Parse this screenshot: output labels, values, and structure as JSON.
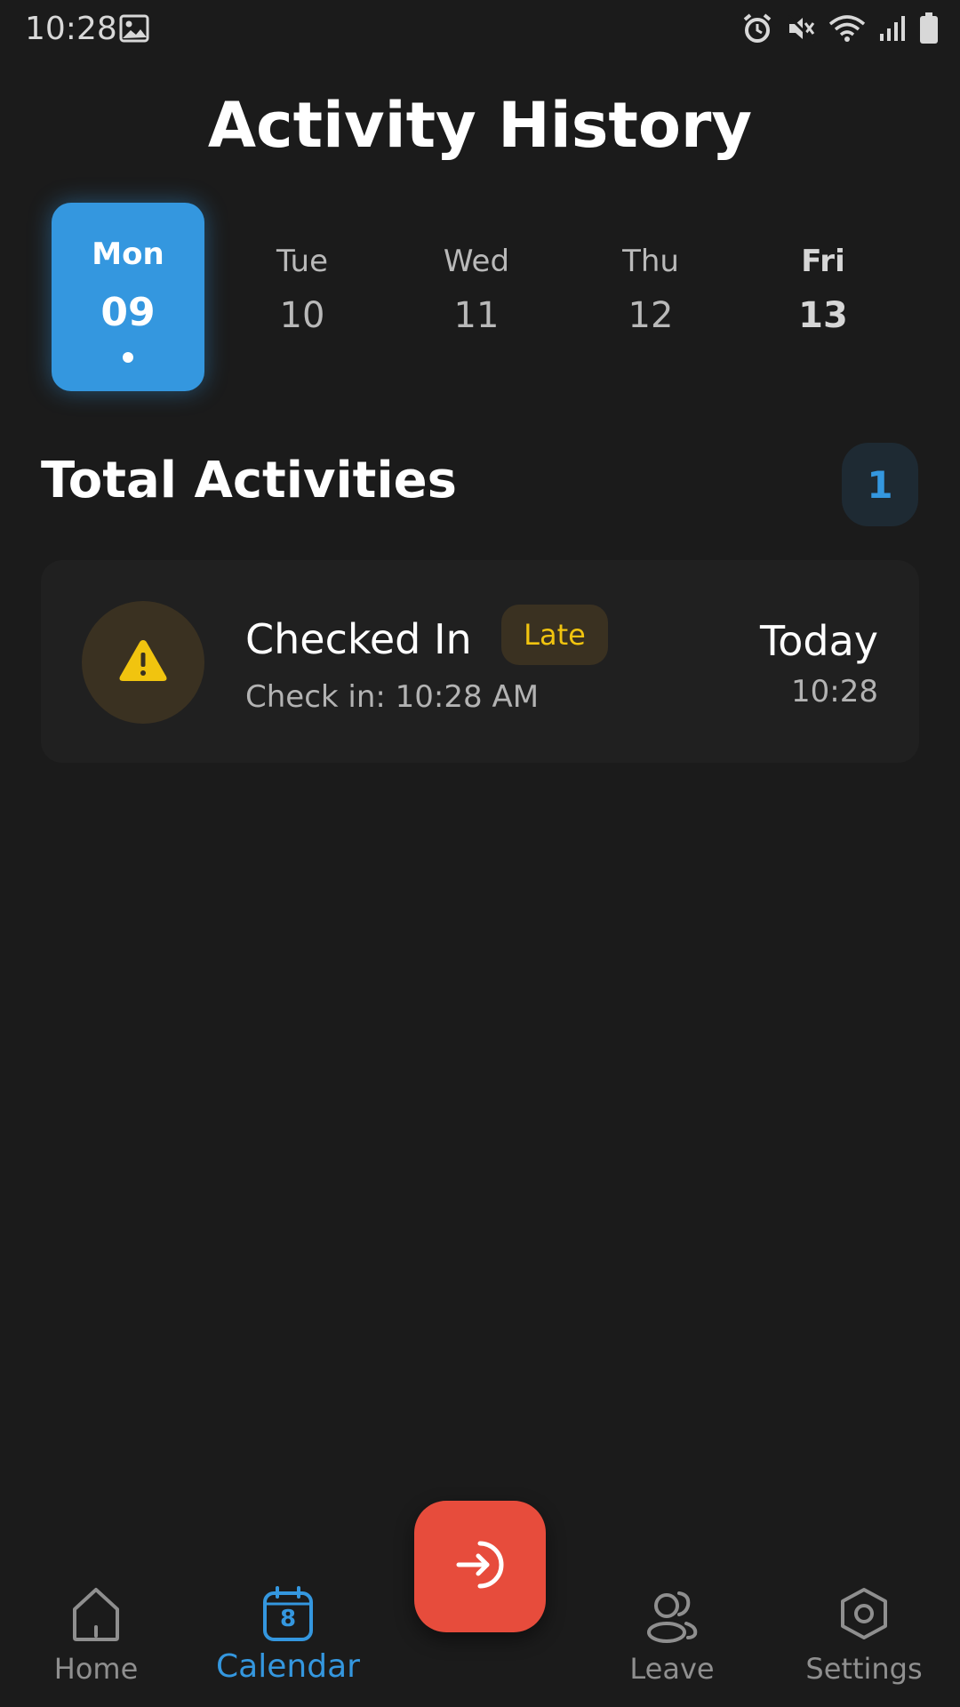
{
  "status_bar": {
    "time": "10:28",
    "icons": [
      "gallery-icon",
      "alarm-icon",
      "mute-icon",
      "wifi-icon",
      "signal-icon",
      "battery-icon"
    ]
  },
  "page": {
    "title": "Activity History"
  },
  "date_strip": {
    "items": [
      {
        "dow": "Mon",
        "day": "09",
        "selected": true,
        "has_activity": true
      },
      {
        "dow": "Tue",
        "day": "10",
        "selected": false
      },
      {
        "dow": "Wed",
        "day": "11",
        "selected": false
      },
      {
        "dow": "Thu",
        "day": "12",
        "selected": false
      },
      {
        "dow": "Fri",
        "day": "13",
        "selected": false,
        "bold": true
      }
    ]
  },
  "summary": {
    "heading": "Total Activities",
    "count": "1"
  },
  "activities": [
    {
      "icon": "warning-icon",
      "title": "Checked In",
      "badge": "Late",
      "subtitle": "Check in: 10:28 AM",
      "day": "Today",
      "time": "10:28"
    }
  ],
  "fab": {
    "icon": "check-in-icon"
  },
  "bottom_nav": {
    "items": [
      {
        "label": "Home",
        "icon": "home-icon",
        "active": false
      },
      {
        "label": "Calendar",
        "icon": "calendar-icon",
        "active": true,
        "icon_text": "8"
      },
      {
        "label": "Leave",
        "icon": "people-icon",
        "active": false
      },
      {
        "label": "Settings",
        "icon": "settings-icon",
        "active": false
      }
    ]
  },
  "colors": {
    "background": "#1b1b1b",
    "accent": "#3497df",
    "warning": "#f1c40f",
    "fab": "#e74c3c",
    "card": "#202020"
  }
}
